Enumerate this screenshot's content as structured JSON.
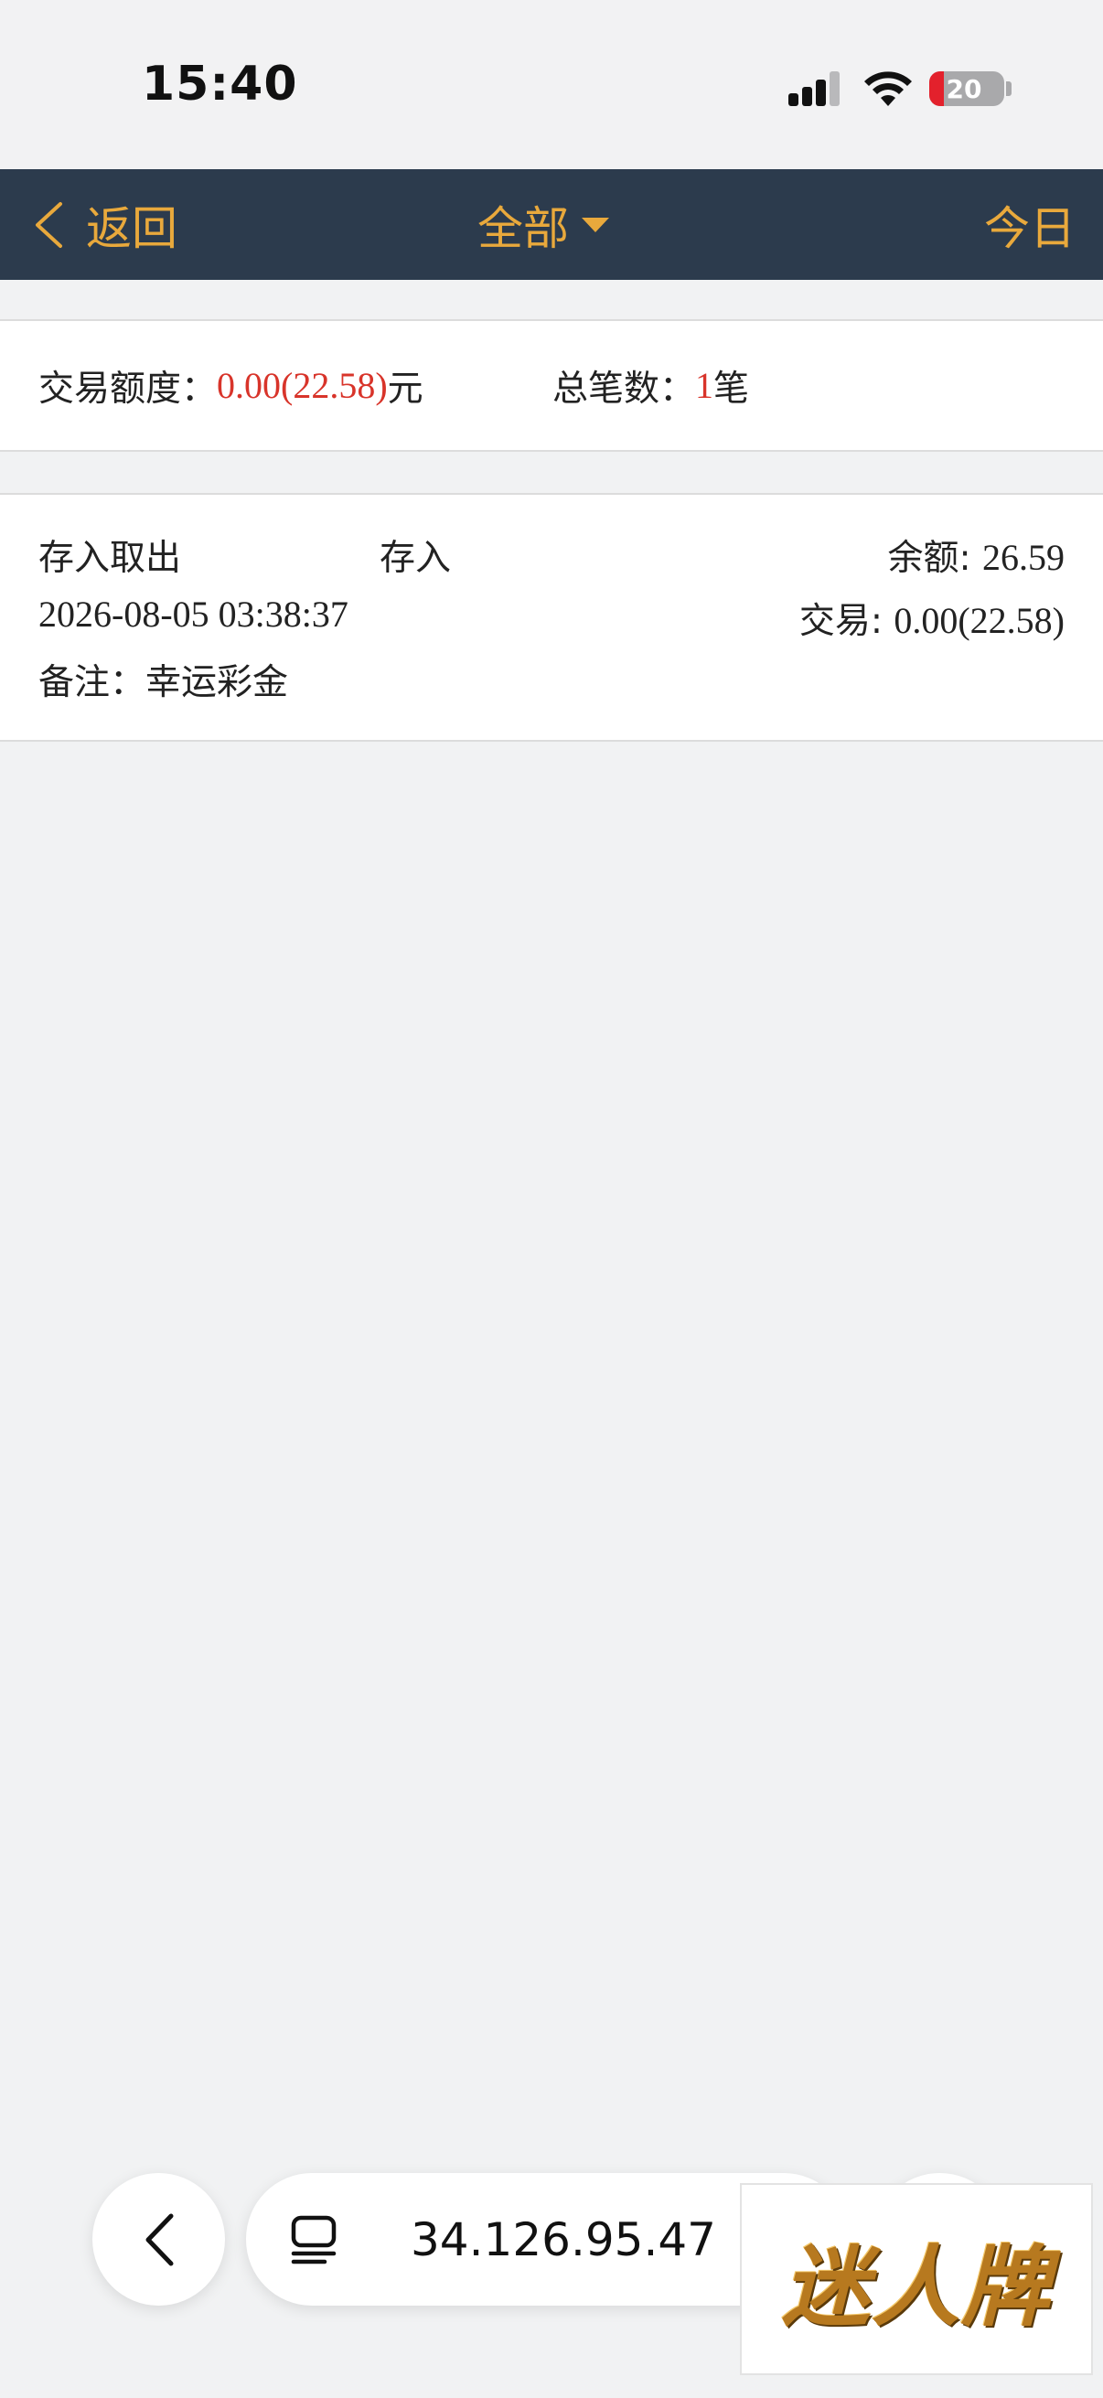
{
  "status_bar": {
    "time": "15:40",
    "battery_level": "20",
    "battery_fraction": 0.2
  },
  "nav": {
    "back_label": "返回",
    "filter_label": "全部",
    "today_label": "今日",
    "bar_color": "#2c3b4d",
    "accent_color": "#e9a93c"
  },
  "summary": {
    "amount_label": "交易额度：",
    "amount_value": "0.00(22.58)",
    "amount_unit": "元",
    "count_label": "总笔数：",
    "count_value": "1",
    "count_unit": "笔",
    "highlight_color": "#d8342a"
  },
  "records": [
    {
      "category": "存入取出",
      "type": "存入",
      "balance_label": "余额: ",
      "balance_value": "26.59",
      "datetime": "2026-08-05 03:38:37",
      "trade_label": "交易: ",
      "trade_value": "0.00(22.58)",
      "note_label": "备注：",
      "note_value": "幸运彩金"
    }
  ],
  "browser": {
    "url": "34.126.95.47"
  },
  "logo": {
    "text": "迷人牌"
  },
  "icons": {
    "back": "chevron-left-icon",
    "filter_caret": "caret-down-icon",
    "browser_back": "chevron-left-icon",
    "tabs": "tabs-icon",
    "signal": "cellular-signal-icon",
    "wifi": "wifi-icon",
    "battery": "battery-icon"
  }
}
